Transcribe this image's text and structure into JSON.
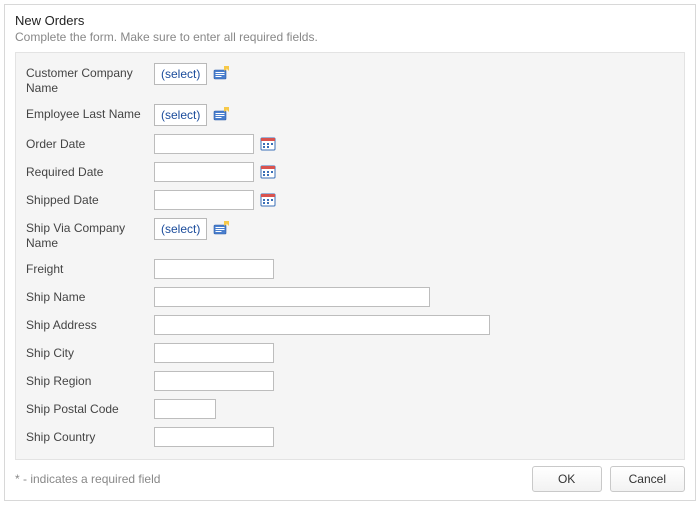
{
  "header": {
    "title": "New Orders",
    "subtitle": "Complete the form. Make sure to enter all required fields."
  },
  "fields": {
    "customer_company_name": {
      "label": "Customer Company Name",
      "select_label": "(select)"
    },
    "employee_last_name": {
      "label": "Employee Last Name",
      "select_label": "(select)"
    },
    "order_date": {
      "label": "Order Date",
      "value": ""
    },
    "required_date": {
      "label": "Required Date",
      "value": ""
    },
    "shipped_date": {
      "label": "Shipped Date",
      "value": ""
    },
    "ship_via_company_name": {
      "label": "Ship Via Company Name",
      "select_label": "(select)"
    },
    "freight": {
      "label": "Freight",
      "value": ""
    },
    "ship_name": {
      "label": "Ship Name",
      "value": ""
    },
    "ship_address": {
      "label": "Ship Address",
      "value": ""
    },
    "ship_city": {
      "label": "Ship City",
      "value": ""
    },
    "ship_region": {
      "label": "Ship Region",
      "value": ""
    },
    "ship_postal_code": {
      "label": "Ship Postal Code",
      "value": ""
    },
    "ship_country": {
      "label": "Ship Country",
      "value": ""
    }
  },
  "footer": {
    "required_note": "* - indicates a required field",
    "ok_label": "OK",
    "cancel_label": "Cancel"
  }
}
